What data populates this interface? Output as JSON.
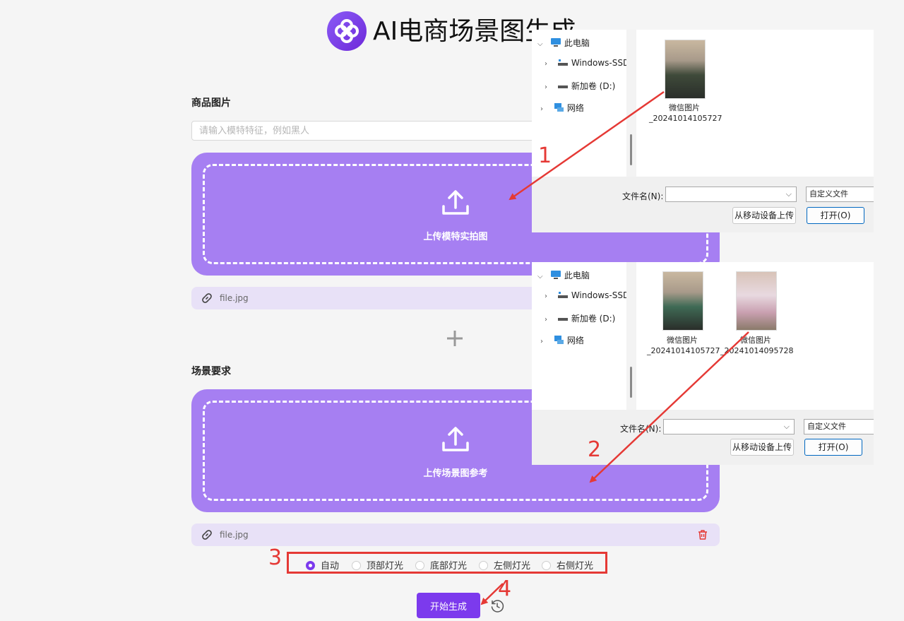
{
  "header": {
    "title": "AI电商场景图生成"
  },
  "form": {
    "product_label": "商品图片",
    "model_placeholder": "请输入模特特征，例如黑人",
    "upload1_text": "上传模特实拍图",
    "file1_name": "file.jpg",
    "scene_label": "场景要求",
    "upload2_text": "上传场景图参考",
    "file2_name": "file.jpg",
    "lighting_options": [
      "自动",
      "顶部灯光",
      "底部灯光",
      "左侧灯光",
      "右侧灯光"
    ],
    "lighting_selected": "自动",
    "submit_label": "开始生成"
  },
  "dialog1": {
    "tree": [
      "此电脑",
      "Windows-SSD",
      "新加卷 (D:)",
      "网络"
    ],
    "files": [
      {
        "caption": "微信图片_20241014105727"
      }
    ],
    "filename_label": "文件名(N):",
    "filetype": "自定义文件",
    "mobile_upload": "从移动设备上传",
    "open": "打开(O)"
  },
  "dialog2": {
    "tree": [
      "此电脑",
      "Windows-SSD",
      "新加卷 (D:)",
      "网络"
    ],
    "files": [
      {
        "caption": "微信图片_20241014105727"
      },
      {
        "caption": "微信图片_20241014095728"
      }
    ],
    "filename_label": "文件名(N):",
    "filetype": "自定义文件",
    "mobile_upload": "从移动设备上传",
    "open": "打开(O)"
  },
  "annotations": [
    "1",
    "2",
    "3",
    "4"
  ],
  "colors": {
    "accent": "#7c3aed",
    "upload_bg": "#a67ff2",
    "annotation": "#e53935"
  }
}
